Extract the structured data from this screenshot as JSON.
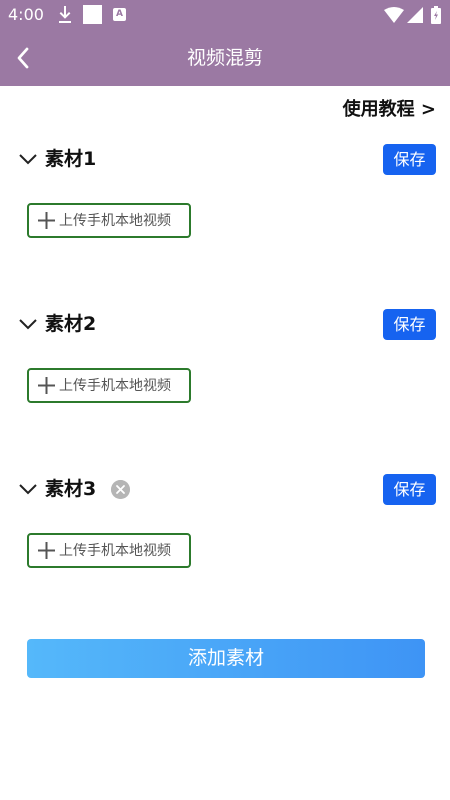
{
  "status_bar": {
    "time": "4:00",
    "indicator": "A",
    "icons": [
      "download-icon",
      "notification-square-icon",
      "accessibility-a-icon",
      "wifi-icon",
      "signal-icon",
      "battery-icon"
    ]
  },
  "nav": {
    "title": "视频混剪",
    "back_icon": "chevron-left-icon",
    "color": "#9b79a3"
  },
  "tutorial_link": "使用教程 >",
  "sections": [
    {
      "title": "素材1",
      "save_label": "保存",
      "upload_label": "上传手机本地视频",
      "removable": false
    },
    {
      "title": "素材2",
      "save_label": "保存",
      "upload_label": "上传手机本地视频",
      "removable": false
    },
    {
      "title": "素材3",
      "save_label": "保存",
      "upload_label": "上传手机本地视频",
      "removable": true
    }
  ],
  "add_material_label": "添加素材",
  "colors": {
    "accent": "#1663f0",
    "upload_border": "#2c7a2c",
    "button_gradient_start": "#55b8fa",
    "button_gradient_end": "#3e94f5"
  }
}
